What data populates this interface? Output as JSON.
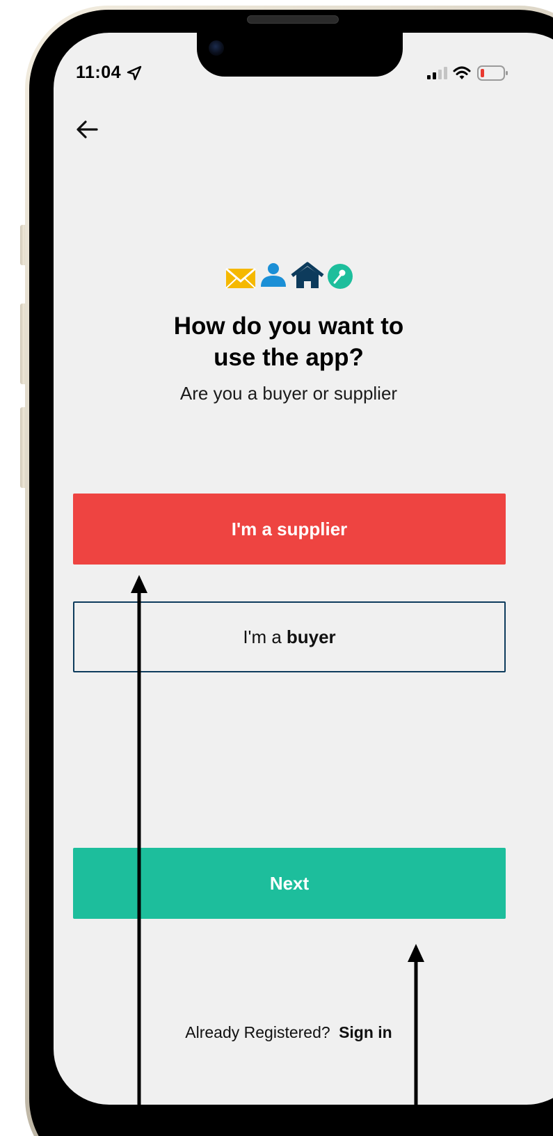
{
  "status_bar": {
    "time": "11:04",
    "location_icon": "location-arrow-icon",
    "signal_icon": "cellular-signal-icon",
    "wifi_icon": "wifi-icon",
    "battery_icon": "battery-low-icon"
  },
  "header": {
    "back_icon": "back-arrow-icon"
  },
  "brand": {
    "icons": [
      "envelope-icon",
      "person-icon",
      "house-icon",
      "pin-icon"
    ],
    "colors": {
      "envelope": "#f5b800",
      "person": "#1b8fd6",
      "house": "#0d3b5c",
      "pin": "#1dbe9c"
    }
  },
  "main": {
    "title_line1": "How do you want to",
    "title_line2": "use the app?",
    "subtitle": "Are you a buyer or supplier",
    "supplier_button_label": "I'm a supplier",
    "buyer_button_prefix": "I'm a",
    "buyer_button_strong": "buyer",
    "next_button_label": "Next"
  },
  "footer": {
    "already_text": "Already Registered?",
    "signin_label": "Sign in"
  },
  "colors": {
    "screen_bg": "#f0f0f0",
    "supplier_red": "#ee4441",
    "buyer_border_navy": "#0d3b5c",
    "next_green": "#1dbe9c"
  }
}
